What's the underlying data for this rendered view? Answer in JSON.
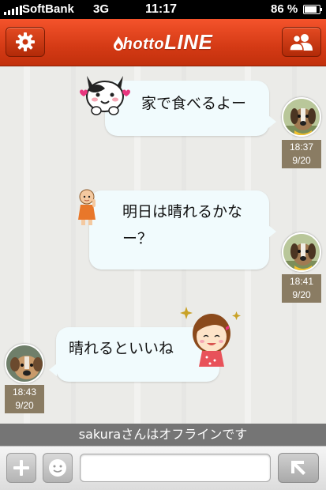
{
  "status_bar": {
    "carrier": "SoftBank",
    "network": "3G",
    "time": "11:17",
    "battery": "86 %",
    "battery_level": 0.86
  },
  "header": {
    "logo_prefix": "hotto",
    "logo_main": "LINE",
    "settings_icon": "gear-icon",
    "contacts_icon": "users-icon",
    "accent_color": "#d43a15"
  },
  "messages": [
    {
      "side": "outgoing",
      "text": "家で食べるよー",
      "time": "18:37",
      "date": "9/20",
      "sticker": "cat-sticker"
    },
    {
      "side": "outgoing",
      "text_line1": "明日は晴れるかな",
      "text_line2": "ー？",
      "time": "18:41",
      "date": "9/20",
      "sticker": "monk-sticker"
    },
    {
      "side": "incoming",
      "text": "晴れるといいね",
      "time": "18:43",
      "date": "9/20",
      "sticker": "girl-sticker"
    }
  ],
  "offline_banner": "sakuraさんはオフラインです",
  "input_bar": {
    "add_icon": "plus-icon",
    "emoji_icon": "smiley-icon",
    "message_value": "",
    "send_icon": "send-arrow-icon"
  }
}
